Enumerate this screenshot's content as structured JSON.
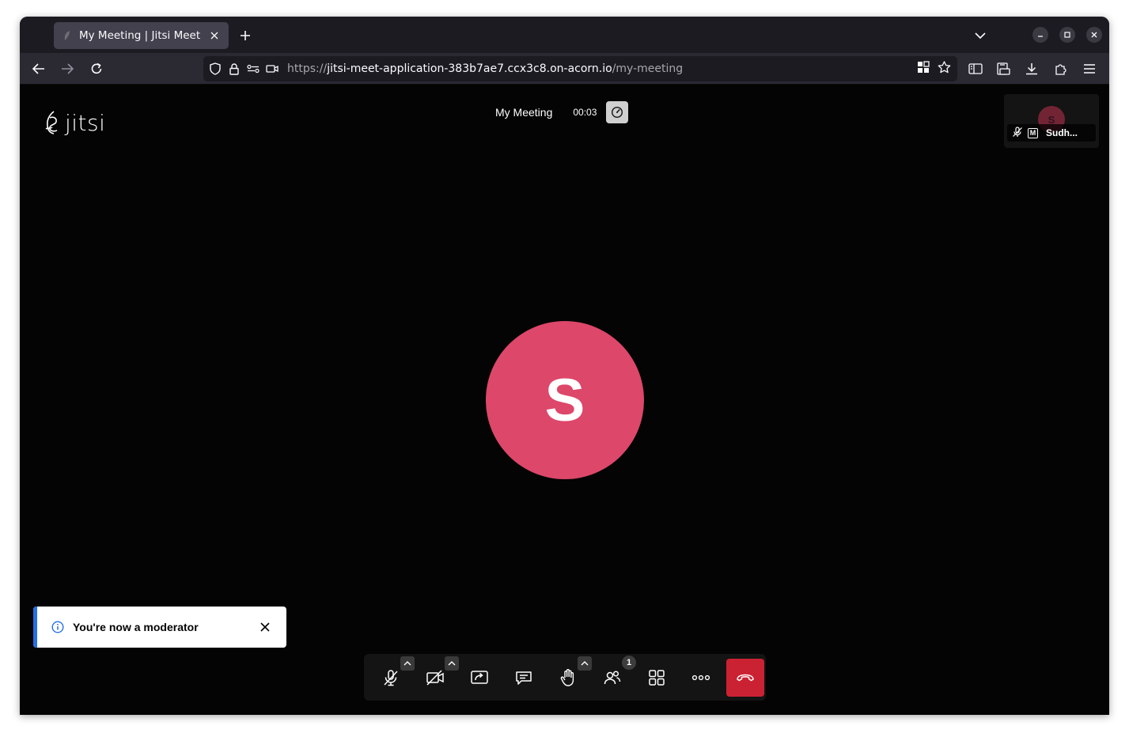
{
  "browser": {
    "tab_title": "My Meeting | Jitsi Meet",
    "url_scheme": "https://",
    "url_host": "jitsi-meet-application-383b7ae7.ccx3c8.on-acorn.io",
    "url_path": "/my-meeting"
  },
  "meeting": {
    "logo_text": "jitsi",
    "subject": "My Meeting",
    "timer": "00:03",
    "avatar_initial": "S",
    "thumbnail": {
      "initial": "S",
      "name": "Sudh...",
      "moderator_badge": "M"
    },
    "notification": {
      "text": "You're now a moderator"
    },
    "toolbar": {
      "participants_count": "1",
      "buttons": [
        "microphone",
        "camera",
        "share-screen",
        "chat",
        "raise-hand",
        "participants",
        "tile-view",
        "more-actions",
        "leave-meeting"
      ]
    }
  },
  "colors": {
    "avatar": "#dd476a",
    "hangup": "#cb2233",
    "notice_accent": "#246fe5",
    "stage_bg": "#040404"
  }
}
